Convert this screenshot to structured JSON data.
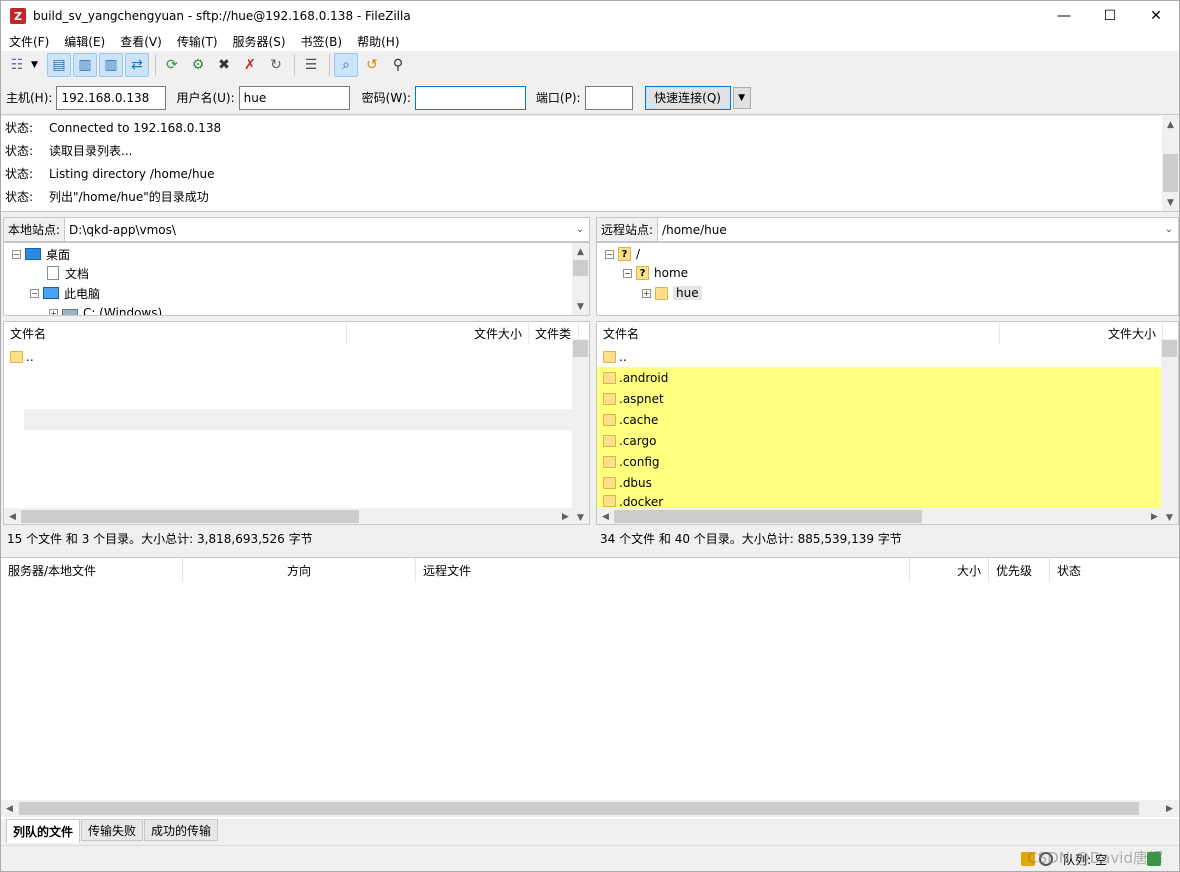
{
  "window": {
    "title": "build_sv_yangchengyuan - sftp://hue@192.168.0.138 - FileZilla",
    "app_icon_letter": "Z",
    "minimize": "—",
    "maximize": "☐",
    "close": "✕"
  },
  "menu": [
    "文件(F)",
    "编辑(E)",
    "查看(V)",
    "传输(T)",
    "服务器(S)",
    "书签(B)",
    "帮助(H)"
  ],
  "toolbar": {
    "icons": [
      {
        "name": "site-manager-icon",
        "glyph": "☷",
        "color": "#5a6e8a"
      },
      {
        "name": "toggle-log-icon",
        "glyph": "▤",
        "color": "#2c6fb5",
        "active": true
      },
      {
        "name": "toggle-local-tree-icon",
        "glyph": "▥",
        "color": "#2c6fb5",
        "active": true
      },
      {
        "name": "toggle-remote-tree-icon",
        "glyph": "▥",
        "color": "#2c6fb5",
        "active": true
      },
      {
        "name": "toggle-queue-icon",
        "glyph": "⇄",
        "color": "#1a73c9",
        "active": true
      },
      {
        "name": "refresh-icon",
        "glyph": "⟳",
        "color": "#1f9a3d"
      },
      {
        "name": "process-queue-icon",
        "glyph": "⚙",
        "color": "#3a8a3a"
      },
      {
        "name": "cancel-icon",
        "glyph": "✖",
        "color": "#333333"
      },
      {
        "name": "disconnect-icon",
        "glyph": "✗",
        "color": "#c0272d"
      },
      {
        "name": "reconnect-icon",
        "glyph": "↻",
        "color": "#606060"
      },
      {
        "name": "directory-filter-icon",
        "glyph": "☰",
        "color": "#505050"
      },
      {
        "name": "search-icon",
        "glyph": "⌕",
        "color": "#2c6fb5",
        "active": true
      },
      {
        "name": "sync-browse-icon",
        "glyph": "↺",
        "color": "#d18a00"
      },
      {
        "name": "find-files-icon",
        "glyph": "⚲",
        "color": "#333333"
      }
    ]
  },
  "quickconnect": {
    "host_label": "主机(H):",
    "host_value": "192.168.0.138",
    "user_label": "用户名(U):",
    "user_value": "hue",
    "pass_label": "密码(W):",
    "pass_value": "",
    "port_label": "端口(P):",
    "port_value": "",
    "button": "快速连接(Q)",
    "dropdown": "▼"
  },
  "log": [
    {
      "label": "状态:",
      "text": "Connected to 192.168.0.138"
    },
    {
      "label": "状态:",
      "text": "读取目录列表..."
    },
    {
      "label": "状态:",
      "text": "Listing directory /home/hue"
    },
    {
      "label": "状态:",
      "text": "列出\"/home/hue\"的目录成功"
    }
  ],
  "local": {
    "site_label": "本地站点:",
    "path": "D:\\qkd-app\\vmos\\",
    "tree": [
      {
        "label": "桌面",
        "expander": "−"
      },
      {
        "label": "文档"
      },
      {
        "label": "此电脑",
        "expander": "−"
      },
      {
        "label": "C: (Windows)",
        "expander": "+"
      }
    ],
    "columns": [
      "文件名",
      "文件大小",
      "文件类"
    ],
    "files": [
      ".."
    ],
    "summary": "15 个文件 和 3 个目录。大小总计: 3,818,693,526 字节"
  },
  "remote": {
    "site_label": "远程站点:",
    "path": "/home/hue",
    "tree": [
      {
        "label": "/",
        "expander": "−"
      },
      {
        "label": "home",
        "expander": "−"
      },
      {
        "label": "hue",
        "expander": "+"
      }
    ],
    "columns": [
      "文件名",
      "文件大小"
    ],
    "files": [
      "..",
      ".android",
      ".aspnet",
      ".cache",
      ".cargo",
      ".config",
      ".dbus",
      ".docker"
    ],
    "summary": "34 个文件 和 40 个目录。大小总计: 885,539,139 字节"
  },
  "queue": {
    "columns": [
      "服务器/本地文件",
      "方向",
      "远程文件",
      "大小",
      "优先级",
      "状态"
    ]
  },
  "tabs": [
    "列队的文件",
    "传输失败",
    "成功的传输"
  ],
  "statusbar": {
    "queue": "队列: 空"
  },
  "watermark": "CSDN @David唐辉",
  "colors": {
    "highlight": "#ffff80",
    "accent": "#0078d7",
    "folder": "#ffe08a"
  }
}
